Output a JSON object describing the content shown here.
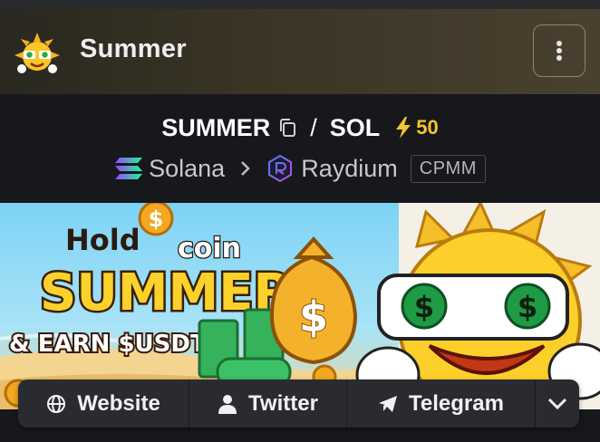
{
  "header": {
    "title": "Summer",
    "avatar_icon": "sun-mascot-avatar",
    "menu_icon": "vertical-dots-icon"
  },
  "pair": {
    "base": "SUMMER",
    "separator": "/",
    "quote": "SOL",
    "boost_count": "50",
    "boost_color": "#f4c431"
  },
  "chain": {
    "name": "Solana",
    "dex": "Raydium",
    "pool_type": "CPMM"
  },
  "banner": {
    "line1": "Hold",
    "line2": "coin",
    "line3": "SUMMER",
    "line4": "& EARN $USDT"
  },
  "links": {
    "website": "Website",
    "twitter": "Twitter",
    "telegram": "Telegram"
  }
}
